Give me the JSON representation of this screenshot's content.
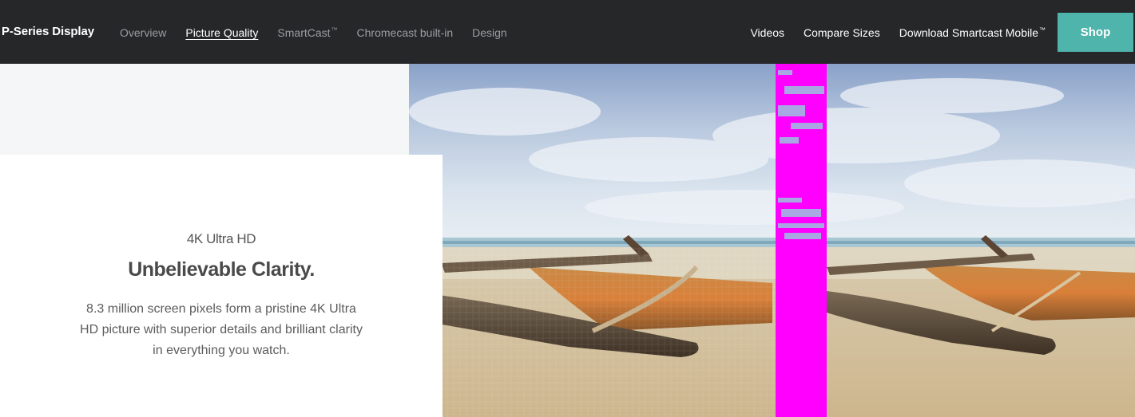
{
  "nav": {
    "brand": "P-Series Display",
    "left_links": [
      {
        "label": "Overview",
        "active": false
      },
      {
        "label": "Picture Quality",
        "active": true
      },
      {
        "label": "SmartCast",
        "tm": "™",
        "active": false
      },
      {
        "label": "Chromecast built-in",
        "active": false
      },
      {
        "label": "Design",
        "active": false
      }
    ],
    "right_links": [
      {
        "label": "Videos"
      },
      {
        "label": "Compare Sizes"
      },
      {
        "label": "Download Smartcast Mobile",
        "tm": "™"
      }
    ],
    "shop_label": "Shop"
  },
  "feature": {
    "eyebrow": "4K Ultra HD",
    "headline": "Unbelievable Clarity.",
    "body": "8.3 million screen pixels form a pristine 4K Ultra HD picture with superior details and brilliant clarity in everything you watch."
  },
  "colors": {
    "nav_bg": "#262729",
    "shop_bg": "#4fb5ac",
    "divider": "#ff00ff"
  }
}
